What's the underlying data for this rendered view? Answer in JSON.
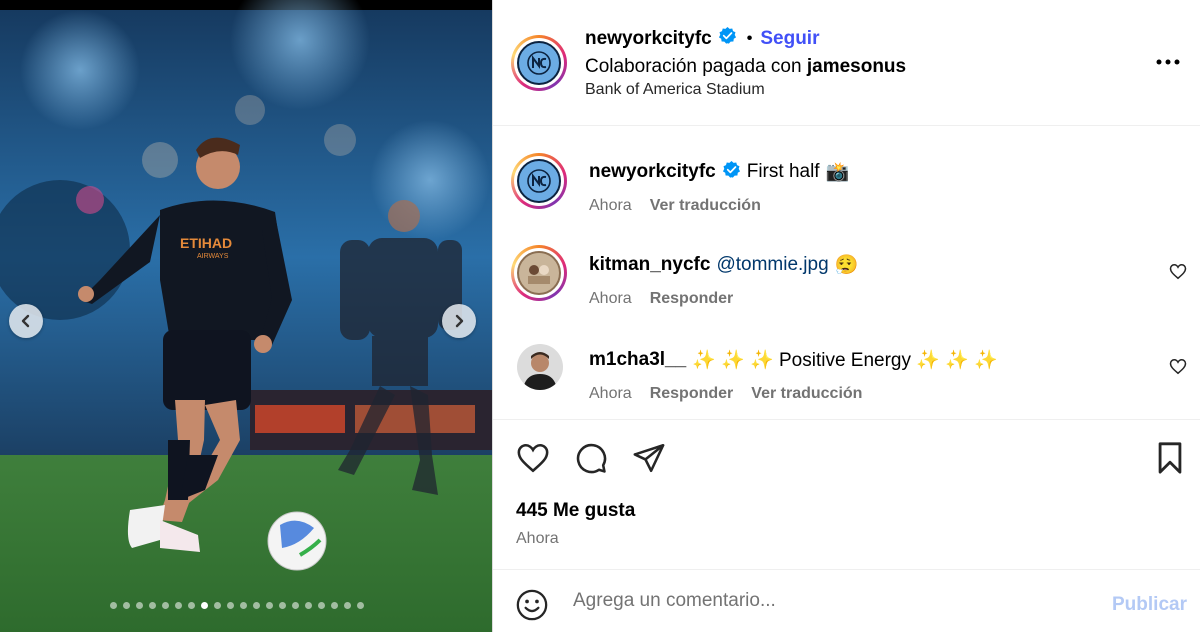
{
  "post": {
    "media": {
      "image_description_icon": "soccer-player-photo",
      "jersey_text": "ETIHAD",
      "jersey_subtext": "AIRWAYS",
      "carousel_total": 20,
      "carousel_active_index": 7
    },
    "header": {
      "username": "newyorkcityfc",
      "bullet": "•",
      "follow_label": "Seguir",
      "collab_prefix": "Colaboración pagada con",
      "collab_partner": "jamesonus",
      "location": "Bank of America Stadium"
    },
    "caption": {
      "username": "newyorkcityfc",
      "text": "First half",
      "emoji": "📸",
      "time": "Ahora",
      "translate_label": "Ver traducción"
    },
    "comments": [
      {
        "username": "kitman_nycfc",
        "mention": "@tommie.jpg",
        "emoji": "😮‍💨",
        "time": "Ahora",
        "reply_label": "Responder"
      },
      {
        "username": "m1cha3l__",
        "text": "✨ ✨ ✨ Positive Energy ✨ ✨ ✨",
        "time": "Ahora",
        "reply_label": "Responder",
        "translate_label": "Ver traducción"
      }
    ],
    "likes_label": "445 Me gusta",
    "posted_time": "Ahora",
    "composer": {
      "placeholder": "Agrega un comentario...",
      "publish_label": "Publicar"
    },
    "colors": {
      "follow_blue": "#4150f7",
      "verified_blue": "#0095f6",
      "publish_disabled": "#b3c9f5",
      "meta_gray": "#737373",
      "nycfc_sky_blue": "#6cace4",
      "nycfc_navy": "#0c2340"
    }
  }
}
